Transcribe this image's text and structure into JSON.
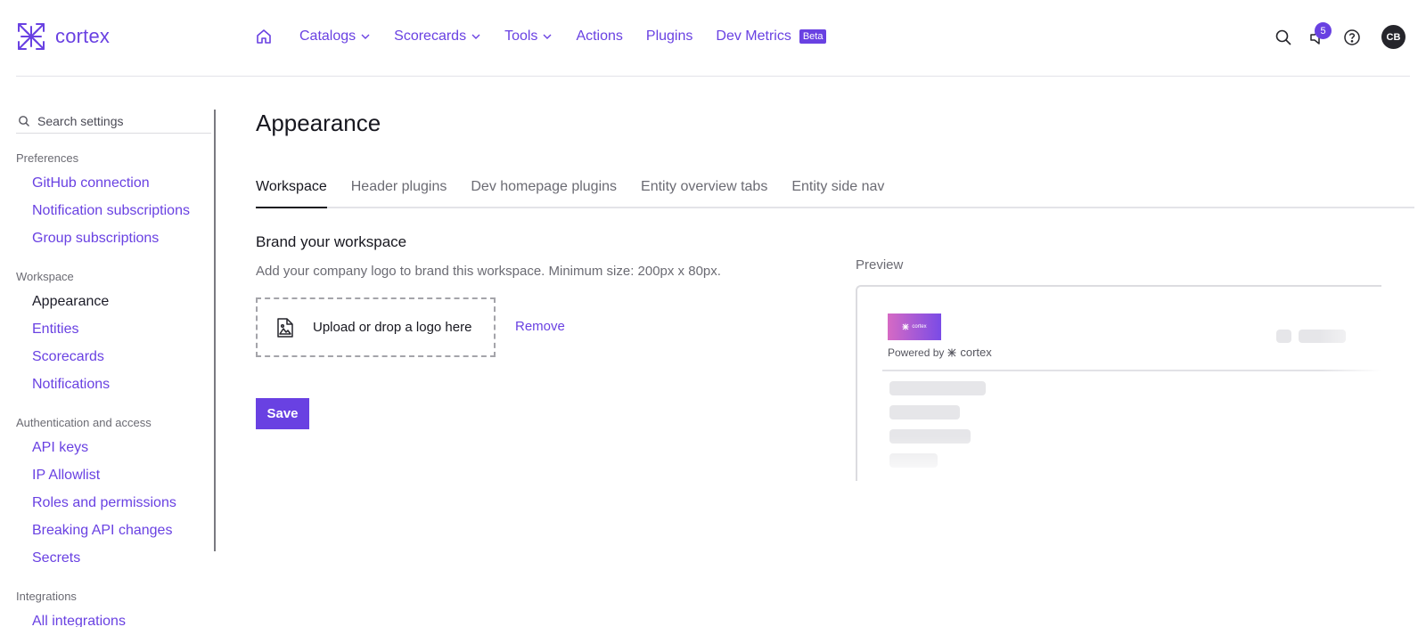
{
  "app": {
    "brand": "cortex"
  },
  "nav": {
    "items": [
      {
        "label": "Catalogs",
        "has_menu": true
      },
      {
        "label": "Scorecards",
        "has_menu": true
      },
      {
        "label": "Tools",
        "has_menu": true
      },
      {
        "label": "Actions",
        "has_menu": false
      },
      {
        "label": "Plugins",
        "has_menu": false
      },
      {
        "label": "Dev Metrics",
        "has_menu": false
      }
    ],
    "beta_label": "Beta",
    "notifications_count": "5",
    "avatar_initials": "CB"
  },
  "sidebar": {
    "search_placeholder": "Search settings",
    "sections": [
      {
        "heading": "Preferences",
        "items": [
          "GitHub connection",
          "Notification subscriptions",
          "Group subscriptions"
        ]
      },
      {
        "heading": "Workspace",
        "items": [
          "Appearance",
          "Entities",
          "Scorecards",
          "Notifications"
        ],
        "active": "Appearance"
      },
      {
        "heading": "Authentication and access",
        "items": [
          "API keys",
          "IP Allowlist",
          "Roles and permissions",
          "Breaking API changes",
          "Secrets"
        ]
      },
      {
        "heading": "Integrations",
        "items": [
          "All integrations"
        ]
      }
    ]
  },
  "main": {
    "title": "Appearance",
    "tabs": [
      "Workspace",
      "Header plugins",
      "Dev homepage plugins",
      "Entity overview tabs",
      "Entity side nav"
    ],
    "active_tab": "Workspace",
    "brand": {
      "title": "Brand your workspace",
      "description": "Add your company logo to brand this workspace. Minimum size: 200px x 80px.",
      "upload_label": "Upload or drop a logo here",
      "remove_label": "Remove",
      "save_label": "Save"
    },
    "preview": {
      "label": "Preview",
      "logo_text": "cortex",
      "powered_by": "Powered by",
      "powered_brand": "cortex"
    }
  },
  "colors": {
    "accent": "#6941e2",
    "text": "#1c1c28",
    "muted": "#6b6b73"
  },
  "icons": [
    "cortex-logo-icon",
    "home-icon",
    "chevron-down-icon",
    "search-icon",
    "notification-icon",
    "help-icon",
    "image-file-icon"
  ]
}
